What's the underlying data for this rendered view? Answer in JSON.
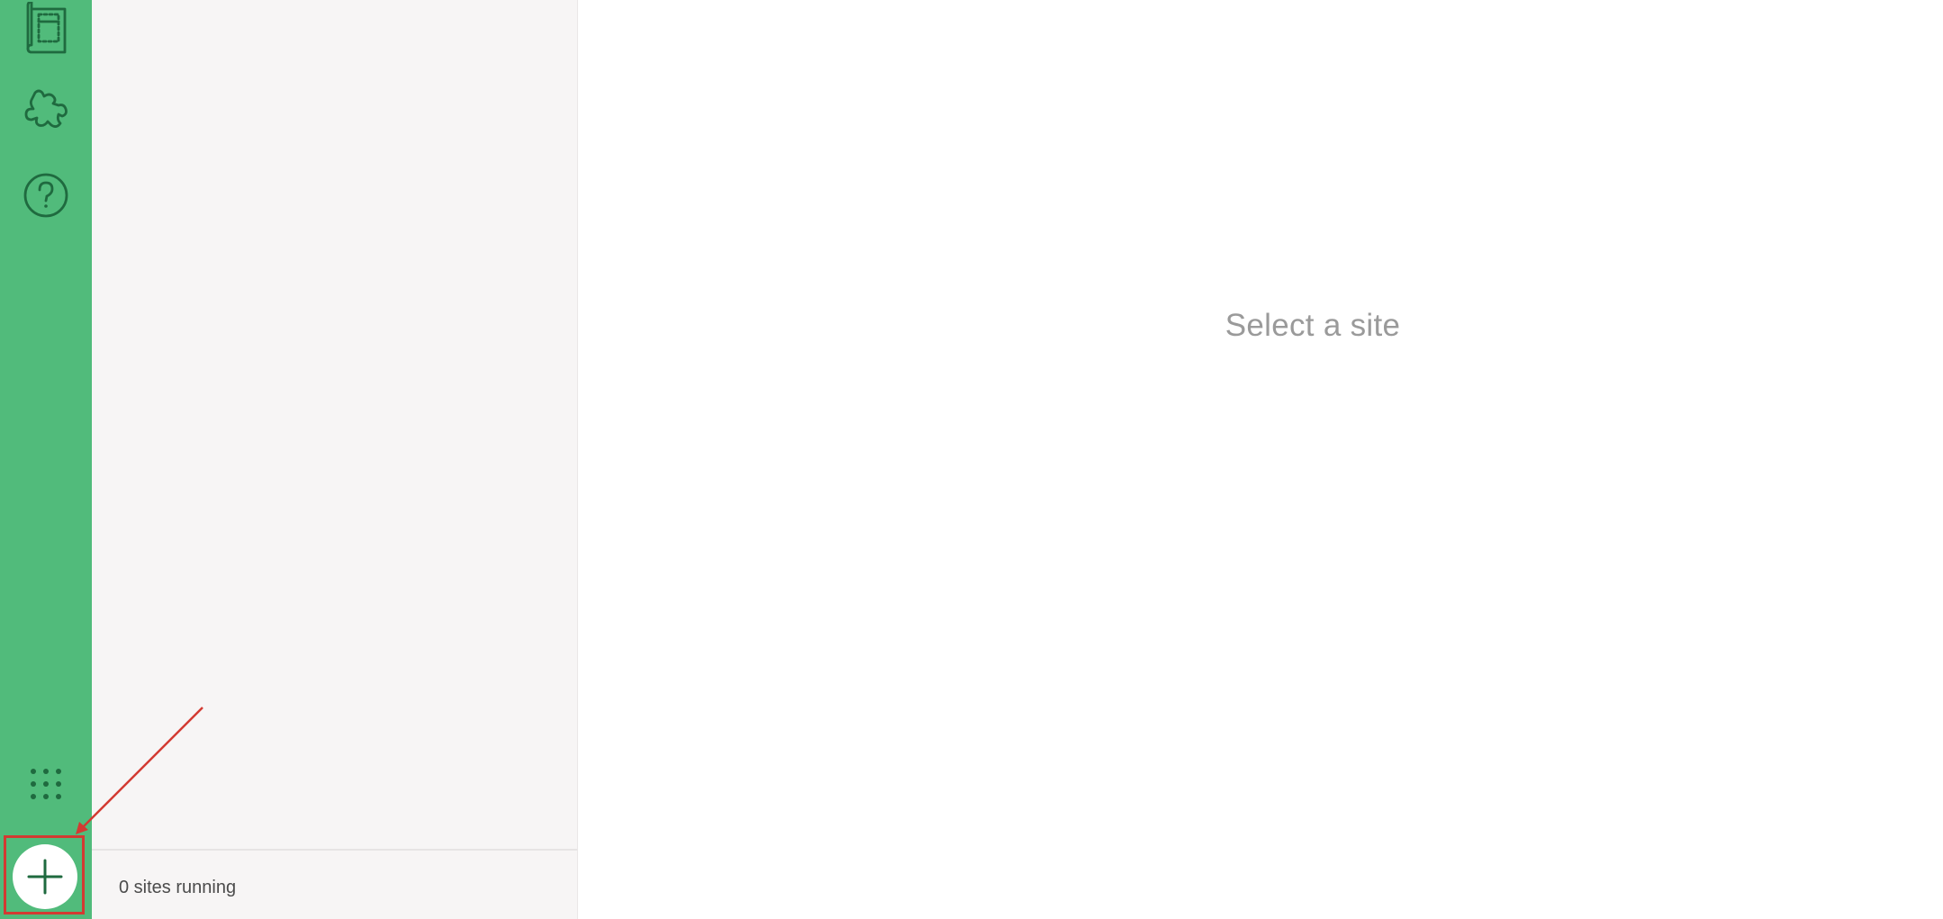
{
  "sidebar": {
    "items": [
      {
        "icon": "blueprint-icon"
      },
      {
        "icon": "puzzle-addons-icon"
      },
      {
        "icon": "help-icon",
        "glyph": "?"
      },
      {
        "icon": "dots-grid-icon"
      }
    ],
    "add_site": {
      "icon": "plus-icon"
    }
  },
  "site_list": {
    "status": "0 sites running"
  },
  "main": {
    "empty_message": "Select a site"
  },
  "colors": {
    "rail": "#51bb7b",
    "icon": "#1f6a3f",
    "annotation": "#d33a32"
  }
}
